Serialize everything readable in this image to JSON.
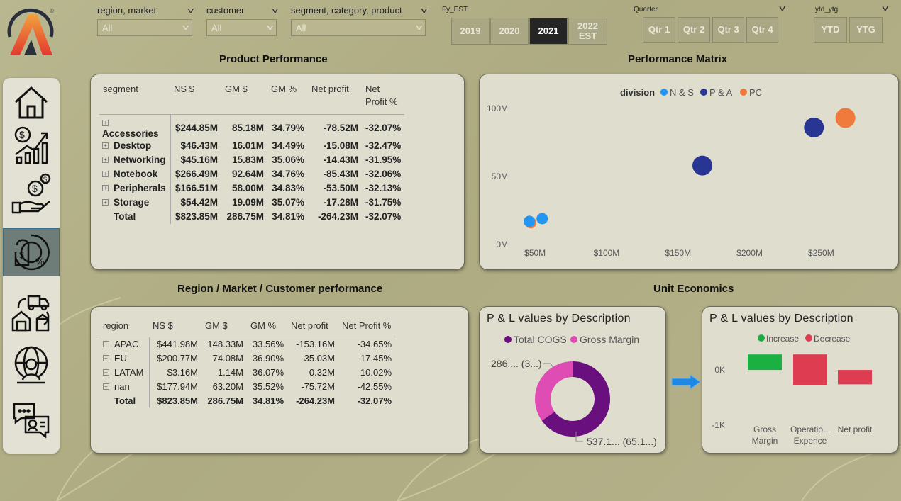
{
  "filters": {
    "region": {
      "label": "region, market",
      "value": "All"
    },
    "customer": {
      "label": "customer",
      "value": "All"
    },
    "segment": {
      "label": "segment, category, product",
      "value": "All"
    }
  },
  "fy": {
    "label": "Fy_EST",
    "buttons": [
      "2019",
      "2020",
      "2021",
      "2022 EST"
    ],
    "selected": "2021"
  },
  "quarter": {
    "label": "Quarter",
    "buttons": [
      "Qtr 1",
      "Qtr 2",
      "Qtr 3",
      "Qtr 4"
    ]
  },
  "ytd": {
    "label": "ytd_ytg",
    "buttons": [
      "YTD",
      "YTG"
    ]
  },
  "colors": {
    "ns": "#2196f3",
    "pa": "#283593",
    "pc": "#ef7a3c",
    "cogs": "#6a0f7e",
    "gross_margin": "#df4db4",
    "increase": "#1ab142",
    "decrease": "#de3c50",
    "accent_arrow": "#1e88e5"
  },
  "icons": {
    "nav": [
      "home-icon",
      "finance-growth-icon",
      "money-hand-icon",
      "profit-analysis-icon",
      "supply-chain-icon",
      "global-customer-icon",
      "chat-support-icon"
    ]
  },
  "product_performance": {
    "title": "Product Performance",
    "headers": [
      "segment",
      "NS $",
      "GM $",
      "GM %",
      "Net profit",
      "Net Profit %"
    ],
    "rows": [
      {
        "name": "Accessories",
        "ns": "$244.85M",
        "gm": "85.18M",
        "gmp": "34.79%",
        "np": "-78.52M",
        "npp": "-32.07%"
      },
      {
        "name": "Desktop",
        "ns": "$46.43M",
        "gm": "16.01M",
        "gmp": "34.49%",
        "np": "-15.08M",
        "npp": "-32.47%"
      },
      {
        "name": "Networking",
        "ns": "$45.16M",
        "gm": "15.83M",
        "gmp": "35.06%",
        "np": "-14.43M",
        "npp": "-31.95%"
      },
      {
        "name": "Notebook",
        "ns": "$266.49M",
        "gm": "92.64M",
        "gmp": "34.76%",
        "np": "-85.43M",
        "npp": "-32.06%"
      },
      {
        "name": "Peripherals",
        "ns": "$166.51M",
        "gm": "58.00M",
        "gmp": "34.83%",
        "np": "-53.50M",
        "npp": "-32.13%"
      },
      {
        "name": "Storage",
        "ns": "$54.42M",
        "gm": "19.09M",
        "gmp": "35.07%",
        "np": "-17.28M",
        "npp": "-31.75%"
      }
    ],
    "total": {
      "name": "Total",
      "ns": "$823.85M",
      "gm": "286.75M",
      "gmp": "34.81%",
      "np": "-264.23M",
      "npp": "-32.07%"
    }
  },
  "region_performance": {
    "title": "Region / Market / Customer performance",
    "headers": [
      "region",
      "NS $",
      "GM $",
      "GM %",
      "Net profit",
      "Net Profit %"
    ],
    "rows": [
      {
        "name": "APAC",
        "ns": "$441.98M",
        "gm": "148.33M",
        "gmp": "33.56%",
        "np": "-153.16M",
        "npp": "-34.65%"
      },
      {
        "name": "EU",
        "ns": "$200.77M",
        "gm": "74.08M",
        "gmp": "36.90%",
        "np": "-35.03M",
        "npp": "-17.45%"
      },
      {
        "name": "LATAM",
        "ns": "$3.16M",
        "gm": "1.14M",
        "gmp": "36.07%",
        "np": "-0.32M",
        "npp": "-10.02%"
      },
      {
        "name": "nan",
        "ns": "$177.94M",
        "gm": "63.20M",
        "gmp": "35.52%",
        "np": "-75.72M",
        "npp": "-42.55%"
      }
    ],
    "total": {
      "name": "Total",
      "ns": "$823.85M",
      "gm": "286.75M",
      "gmp": "34.81%",
      "np": "-264.23M",
      "npp": "-32.07%"
    }
  },
  "performance_matrix": {
    "title": "Performance Matrix",
    "legend_title": "division",
    "legend": [
      "N & S",
      "P & A",
      "PC"
    ]
  },
  "unit_economics": {
    "title": "Unit Economics",
    "donut_card_title": "P & L values by Description",
    "donut_legend": [
      "Total COGS",
      "Gross Margin"
    ],
    "donut_label_small": "286.... (3...)",
    "donut_label_large": "537.1... (65.1...)",
    "waterfall_card_title": "P & L values by Description",
    "waterfall_legend": [
      "Increase",
      "Decrease"
    ]
  },
  "chart_data": [
    {
      "type": "scatter",
      "legend_title": "division",
      "series": [
        {
          "name": "N & S",
          "points": [
            [
              46,
              17
            ],
            [
              55,
              19
            ]
          ]
        },
        {
          "name": "P & A",
          "points": [
            [
              167,
              58
            ],
            [
              245,
              86
            ]
          ]
        },
        {
          "name": "PC",
          "points": [
            [
              47,
              16
            ],
            [
              267,
              93
            ]
          ]
        }
      ],
      "xticks": [
        "$50M",
        "$100M",
        "$150M",
        "$200M",
        "$250M"
      ],
      "yticks": [
        "0M",
        "50M",
        "100M"
      ],
      "xlim": [
        40,
        290
      ],
      "ylim": [
        0,
        100
      ],
      "legend_position": "top-center"
    },
    {
      "type": "pie",
      "labels": [
        "Total COGS",
        "Gross Margin"
      ],
      "values": [
        537.1,
        286.75
      ],
      "donut": true
    },
    {
      "type": "bar",
      "subtype": "waterfall",
      "categories": [
        "Gross Margin",
        "Operatio... Expence",
        "Net profit"
      ],
      "category_lines": [
        [
          "Gross",
          "Margin"
        ],
        [
          "Operatio...",
          "Expence"
        ],
        [
          "Net profit"
        ]
      ],
      "values": [
        0.28,
        -0.55,
        -0.26
      ],
      "yticks": [
        "0K",
        "-1K"
      ],
      "ylim": [
        -1.1,
        0.5
      ]
    }
  ]
}
